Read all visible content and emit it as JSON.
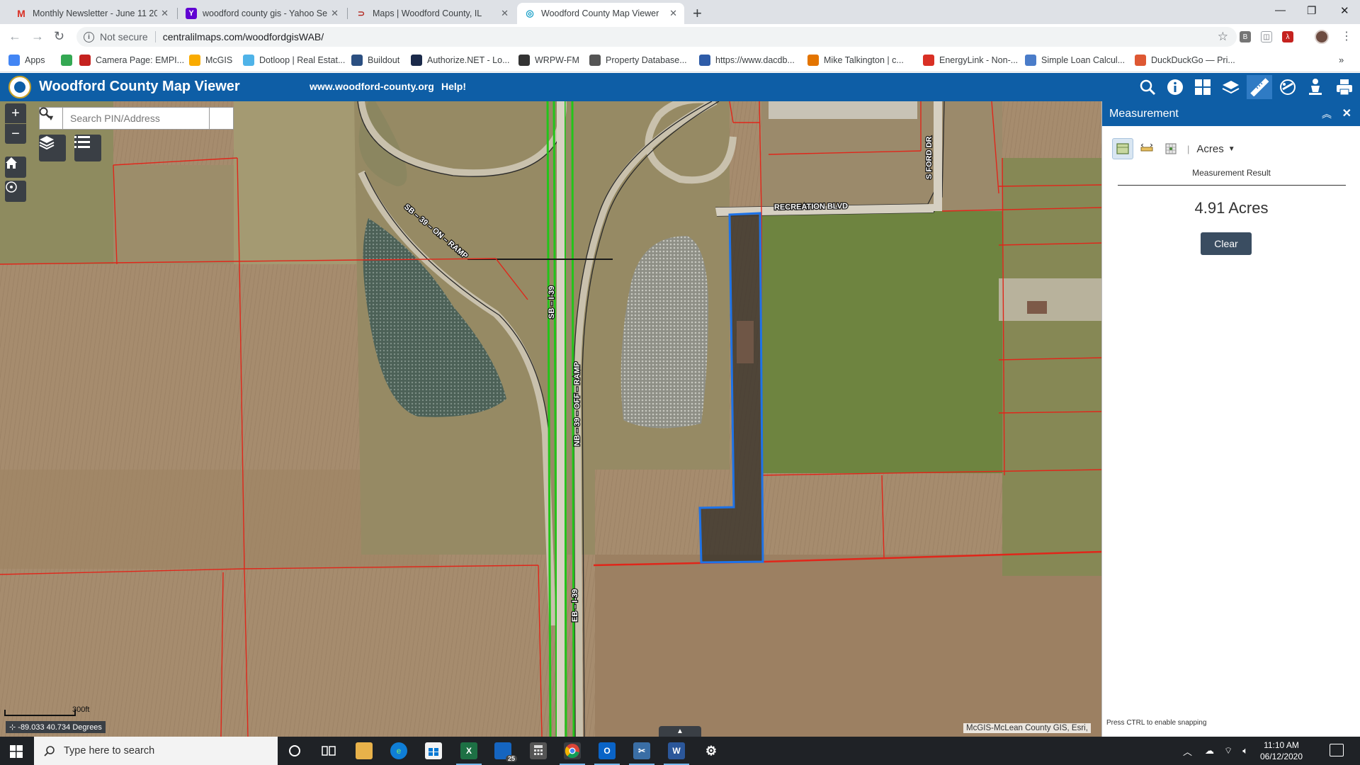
{
  "browser": {
    "tabs": [
      {
        "label": "Monthly Newsletter - June 11 20...",
        "icon": "gmail-icon",
        "color": "#d93025"
      },
      {
        "label": "woodford county gis - Yahoo Sea...",
        "icon": "yahoo-icon",
        "color": "#6001d2"
      },
      {
        "label": "Maps | Woodford County, IL",
        "icon": "maps-icon",
        "color": "#b3261e"
      },
      {
        "label": "Woodford County Map Viewer",
        "icon": "mapviewer-icon",
        "color": "#1da1c8"
      }
    ],
    "address": {
      "security": "Not secure",
      "url": "centralilmaps.com/woodfordgisWAB/"
    },
    "bookmarks": [
      {
        "label": "Apps",
        "color": "#4285f4"
      },
      {
        "label": "",
        "color": "#34a853"
      },
      {
        "label": "Camera Page: EMPI...",
        "color": "#c5221f"
      },
      {
        "label": "McGIS",
        "color": "#f9ab00"
      },
      {
        "label": "Dotloop | Real Estat...",
        "color": "#4fb3e8"
      },
      {
        "label": "Buildout",
        "color": "#2b4f81"
      },
      {
        "label": "Authorize.NET - Lo...",
        "color": "#1b2a4a"
      },
      {
        "label": "WRPW-FM",
        "color": "#333333"
      },
      {
        "label": "Property Database...",
        "color": "#555555"
      },
      {
        "label": "https://www.dacdb...",
        "color": "#2e5ca8"
      },
      {
        "label": "Mike Talkington | c...",
        "color": "#e37400"
      },
      {
        "label": "EnergyLink - Non-...",
        "color": "#d93025"
      },
      {
        "label": "Simple Loan Calcul...",
        "color": "#4a7cc9"
      },
      {
        "label": "DuckDuckGo — Pri...",
        "color": "#de5833"
      }
    ],
    "bookmarks_more": "»"
  },
  "app": {
    "title": "Woodford County Map Viewer",
    "links": [
      "www.woodford-county.org",
      "Help!"
    ],
    "header_icons": [
      "search-icon",
      "info-icon",
      "basemap-gallery-icon",
      "layers-icon",
      "measure-icon",
      "draw-icon",
      "download-icon",
      "print-icon"
    ],
    "header_color": "#0e5ea6"
  },
  "map": {
    "search_placeholder": "Search PIN/Address",
    "road_labels": {
      "ramp_on": "SB – 39 – ON – RAMP",
      "sb": "SB – I-39",
      "nb": "NB – 39 – OFF – RAMP",
      "eb": "EB – I-39",
      "recreation": "RECREATION  BLVD",
      "ford": "S FORD DR"
    },
    "scale_label": "300ft",
    "coordinates": "-89.033 40.734 Degrees",
    "attribution": "McGIS-McLean County GIS, Esri,",
    "parcel_line_color": "#e0261a",
    "selection_color": "#1e73e8"
  },
  "panel": {
    "title": "Measurement",
    "tools": [
      "area-measure-icon",
      "distance-measure-icon",
      "location-measure-icon"
    ],
    "unit": "Acres",
    "result_label": "Measurement Result",
    "result_value": "4.91 Acres",
    "clear_label": "Clear",
    "snap_hint": "Press CTRL to enable snapping"
  },
  "taskbar": {
    "search_placeholder": "Type here to search",
    "mail_badge": "25",
    "time": "11:10 AM",
    "date": "06/12/2020"
  }
}
